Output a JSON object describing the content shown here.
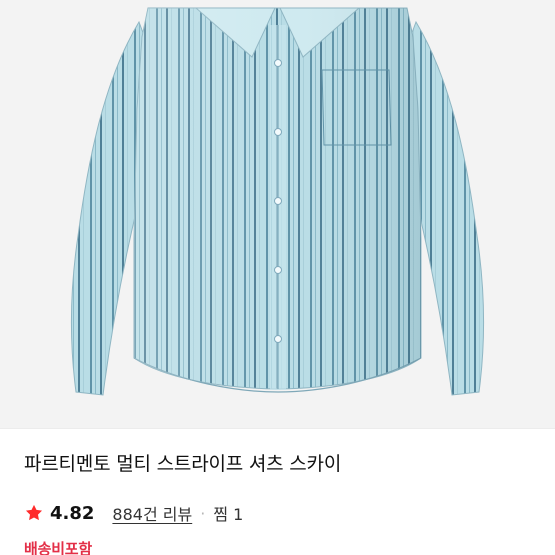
{
  "product": {
    "title": "파르티멘토 멀티 스트라이프 셔츠 스카이",
    "image_icon": "striped-shirt-photo"
  },
  "rating": {
    "score": "4.82",
    "star_icon": "star-icon",
    "star_color": "#ff2b2b"
  },
  "reviews": {
    "label": "884건 리뷰"
  },
  "separator": "·",
  "likes": {
    "label": "찜 1"
  },
  "shipping": {
    "label": "배송비포함",
    "color": "#e32f47"
  }
}
